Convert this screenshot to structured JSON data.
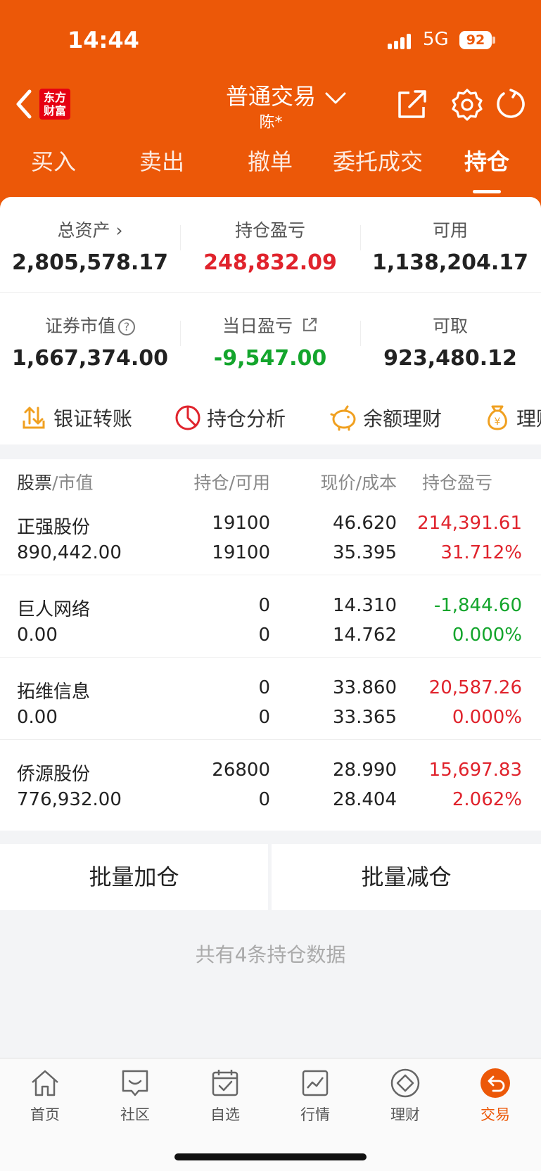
{
  "status": {
    "time": "14:44",
    "network": "5G",
    "battery": "92"
  },
  "header": {
    "logo": "东方\n财富",
    "title": "普通交易",
    "subtitle": "陈*"
  },
  "tabs": [
    "买入",
    "卖出",
    "撤单",
    "委托成交",
    "持仓"
  ],
  "summary": {
    "total_assets_label": "总资产",
    "total_assets": "2,805,578.17",
    "position_pnl_label": "持仓盈亏",
    "position_pnl": "248,832.09",
    "available_label": "可用",
    "available": "1,138,204.17",
    "market_value_label": "证券市值",
    "market_value": "1,667,374.00",
    "daily_pnl_label": "当日盈亏",
    "daily_pnl": "-9,547.00",
    "withdrawable_label": "可取",
    "withdrawable": "923,480.12"
  },
  "shortcuts": [
    "银证转账",
    "持仓分析",
    "余额理财",
    "理财"
  ],
  "table": {
    "headers": {
      "stock": "股票",
      "stock_sub": "/市值",
      "pos": "持仓",
      "pos_sub": "/可用",
      "price": "现价",
      "price_sub": "/成本",
      "pnl": "持仓盈亏"
    },
    "rows": [
      {
        "name": "正强股份",
        "mv": "890,442.00",
        "pos": "19100",
        "avail": "19100",
        "price": "46.620",
        "cost": "35.395",
        "pnl": "214,391.61",
        "pct": "31.712%",
        "dir": "up"
      },
      {
        "name": "巨人网络",
        "mv": "0.00",
        "pos": "0",
        "avail": "0",
        "price": "14.310",
        "cost": "14.762",
        "pnl": "-1,844.60",
        "pct": "0.000%",
        "dir": "down"
      },
      {
        "name": "拓维信息",
        "mv": "0.00",
        "pos": "0",
        "avail": "0",
        "price": "33.860",
        "cost": "33.365",
        "pnl": "20,587.26",
        "pct": "0.000%",
        "dir": "up"
      },
      {
        "name": "侨源股份",
        "mv": "776,932.00",
        "pos": "26800",
        "avail": "0",
        "price": "28.990",
        "cost": "28.404",
        "pnl": "15,697.83",
        "pct": "2.062%",
        "dir": "up"
      }
    ]
  },
  "actions": {
    "batch_add": "批量加仓",
    "batch_reduce": "批量减仓"
  },
  "footer_note": "共有4条持仓数据",
  "nav": [
    "首页",
    "社区",
    "自选",
    "行情",
    "理财",
    "交易"
  ],
  "colors": {
    "brand": "#ec5808",
    "up": "#e0232c",
    "down": "#13a52c"
  }
}
